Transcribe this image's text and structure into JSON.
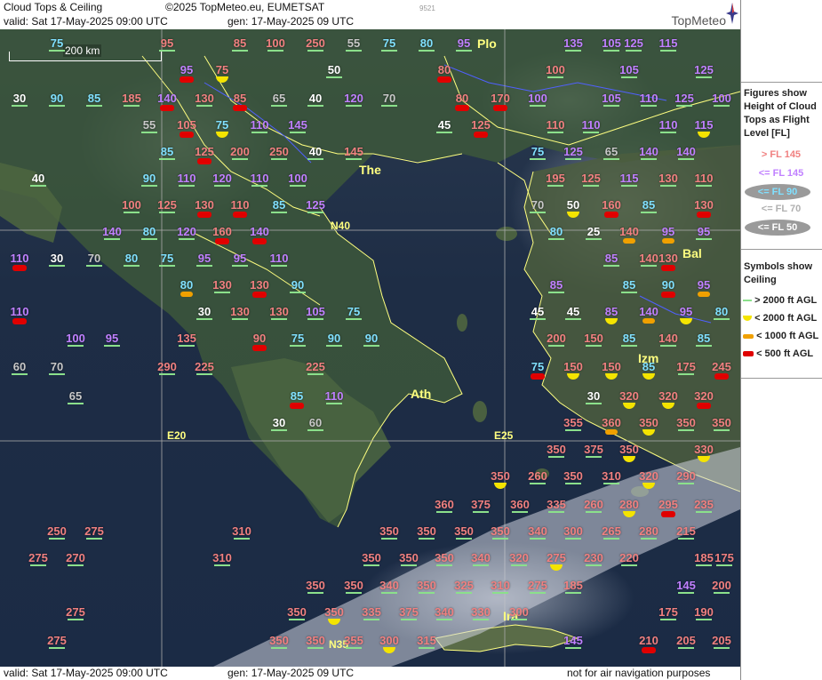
{
  "header": {
    "title": "Cloud Tops & Ceiling",
    "copyright": "©2025 TopMeteo.eu, EUMETSAT",
    "valid": "valid:  Sat  17-May-2025  09:00 UTC",
    "gen": "gen: 17-May-2025 09 UTC",
    "code": "9521",
    "logo": "TopMeteo"
  },
  "footer": {
    "valid": "valid:  Sat  17-May-2025  09:00 UTC",
    "gen": "gen: 17-May-2025 09 UTC",
    "disclaimer": "not for air navigation purposes"
  },
  "scale": "200 km",
  "legend": {
    "figures_title": "Figures show Height of Cloud Tops as Flight Level  [FL]",
    "levels": [
      {
        "label": "> FL 145",
        "color": "#f08080"
      },
      {
        "label": "<= FL 145",
        "color": "#c080ff"
      },
      {
        "label": "<= FL 90",
        "color": "#80e0ff"
      },
      {
        "label": "<= FL 70",
        "color": "#c8c8c8"
      },
      {
        "label": "<= FL 50",
        "color": "#ffffff"
      }
    ],
    "symbols_title": "Symbols show Ceiling",
    "symbols": [
      {
        "label": "> 2000 ft AGL",
        "icon": "green-line-icon"
      },
      {
        "label": "< 2000 ft AGL",
        "icon": "yellow-half-disc-icon"
      },
      {
        "label": "< 1000 ft AGL",
        "icon": "orange-bar-icon"
      },
      {
        "label": "< 500 ft AGL",
        "icon": "red-bar-icon"
      }
    ]
  },
  "cities": [
    "The",
    "Ath",
    "Izm",
    "Bal",
    "Plo",
    "Ira"
  ],
  "gridlabels": [
    "N40",
    "N35",
    "E20",
    "E25"
  ],
  "observations": [
    {
      "v": "75",
      "c": "f",
      "s": "ln"
    },
    {
      "v": "95",
      "c": "h",
      "s": "ln"
    },
    {
      "v": "85",
      "c": "h",
      "s": "ln"
    },
    {
      "v": "250",
      "c": "h",
      "s": "ln"
    },
    {
      "v": "100",
      "c": "h",
      "s": "ln"
    },
    {
      "v": "55",
      "c": "g",
      "s": "ln"
    },
    {
      "v": "75",
      "c": "f",
      "s": "ln"
    },
    {
      "v": "80",
      "c": "f",
      "s": "ln"
    },
    {
      "v": "95",
      "c": "m",
      "s": "ln"
    },
    {
      "v": "Plo",
      "c": "c",
      "s": ""
    },
    {
      "v": "125",
      "c": "m",
      "s": "ln"
    },
    {
      "v": "135",
      "c": "m",
      "s": "ln"
    },
    {
      "v": "105",
      "c": "m",
      "s": "ln"
    },
    {
      "v": "115",
      "c": "m",
      "s": "ln"
    },
    {
      "v": "95",
      "c": "m",
      "s": "re"
    },
    {
      "v": "75",
      "c": "h",
      "s": "ye"
    },
    {
      "v": "50",
      "c": "w",
      "s": "ln"
    },
    {
      "v": "80",
      "c": "h",
      "s": "re"
    },
    {
      "v": "100",
      "c": "h",
      "s": "ln"
    },
    {
      "v": "105",
      "c": "m",
      "s": "ln"
    },
    {
      "v": "125",
      "c": "m",
      "s": "ln"
    },
    {
      "v": "30",
      "c": "w",
      "s": "ln"
    },
    {
      "v": "90",
      "c": "f",
      "s": "ln"
    },
    {
      "v": "85",
      "c": "f",
      "s": "ln"
    },
    {
      "v": "185",
      "c": "h",
      "s": "ln"
    },
    {
      "v": "140",
      "c": "m",
      "s": "re"
    },
    {
      "v": "130",
      "c": "h",
      "s": "ln"
    },
    {
      "v": "85",
      "c": "h",
      "s": "re"
    },
    {
      "v": "65",
      "c": "g",
      "s": "ln"
    },
    {
      "v": "40",
      "c": "w",
      "s": "ln"
    },
    {
      "v": "120",
      "c": "m",
      "s": "ln"
    },
    {
      "v": "70",
      "c": "g",
      "s": "ln"
    },
    {
      "v": "80",
      "c": "h",
      "s": "re"
    },
    {
      "v": "170",
      "c": "h",
      "s": "re"
    },
    {
      "v": "100",
      "c": "m",
      "s": "ln"
    },
    {
      "v": "105",
      "c": "m",
      "s": "ln"
    },
    {
      "v": "110",
      "c": "m",
      "s": "ln"
    },
    {
      "v": "125",
      "c": "m",
      "s": "ln"
    },
    {
      "v": "100",
      "c": "m",
      "s": "ln"
    },
    {
      "v": "55",
      "c": "g",
      "s": "ln"
    },
    {
      "v": "105",
      "c": "h",
      "s": "re"
    },
    {
      "v": "75",
      "c": "f",
      "s": "ye"
    },
    {
      "v": "110",
      "c": "m",
      "s": "ln"
    },
    {
      "v": "145",
      "c": "m",
      "s": "ln"
    },
    {
      "v": "45",
      "c": "w",
      "s": "ln"
    },
    {
      "v": "125",
      "c": "h",
      "s": "re"
    },
    {
      "v": "110",
      "c": "h",
      "s": "ln"
    },
    {
      "v": "110",
      "c": "m",
      "s": "ln"
    },
    {
      "v": "110",
      "c": "m",
      "s": "ln"
    },
    {
      "v": "115",
      "c": "m",
      "s": "ye"
    },
    {
      "v": "85",
      "c": "f",
      "s": "ln"
    },
    {
      "v": "125",
      "c": "h",
      "s": "re"
    },
    {
      "v": "200",
      "c": "h",
      "s": "ln"
    },
    {
      "v": "250",
      "c": "h",
      "s": "ln"
    },
    {
      "v": "40",
      "c": "w",
      "s": "ln"
    },
    {
      "v": "145",
      "c": "h",
      "s": "ln"
    },
    {
      "v": "75",
      "c": "f",
      "s": "ln"
    },
    {
      "v": "125",
      "c": "m",
      "s": "ln"
    },
    {
      "v": "65",
      "c": "g",
      "s": "ln"
    },
    {
      "v": "140",
      "c": "m",
      "s": "ln"
    },
    {
      "v": "140",
      "c": "m",
      "s": "ln"
    },
    {
      "v": "40",
      "c": "w",
      "s": "ln"
    },
    {
      "v": "90",
      "c": "f",
      "s": "ln"
    },
    {
      "v": "110",
      "c": "m",
      "s": "ln"
    },
    {
      "v": "120",
      "c": "m",
      "s": "ln"
    },
    {
      "v": "110",
      "c": "m",
      "s": "ln"
    },
    {
      "v": "100",
      "c": "m",
      "s": "ln"
    },
    {
      "v": "195",
      "c": "h",
      "s": "ln"
    },
    {
      "v": "125",
      "c": "h",
      "s": "ln"
    },
    {
      "v": "115",
      "c": "m",
      "s": "ln"
    },
    {
      "v": "130",
      "c": "h",
      "s": "ln"
    },
    {
      "v": "110",
      "c": "h",
      "s": "ln"
    },
    {
      "v": "100",
      "c": "h",
      "s": "ln"
    },
    {
      "v": "125",
      "c": "h",
      "s": "ln"
    },
    {
      "v": "130",
      "c": "h",
      "s": "re"
    },
    {
      "v": "110",
      "c": "h",
      "s": "re"
    },
    {
      "v": "85",
      "c": "f",
      "s": "ln"
    },
    {
      "v": "125",
      "c": "m",
      "s": "ln"
    },
    {
      "v": "70",
      "c": "g",
      "s": "ln"
    },
    {
      "v": "50",
      "c": "w",
      "s": "ye"
    },
    {
      "v": "160",
      "c": "h",
      "s": "re"
    },
    {
      "v": "85",
      "c": "f",
      "s": "ln"
    },
    {
      "v": "130",
      "c": "h",
      "s": "re"
    },
    {
      "v": "140",
      "c": "m",
      "s": "ln"
    },
    {
      "v": "80",
      "c": "f",
      "s": "ln"
    },
    {
      "v": "120",
      "c": "m",
      "s": "ln"
    },
    {
      "v": "160",
      "c": "h",
      "s": "re"
    },
    {
      "v": "140",
      "c": "m",
      "s": "re"
    },
    {
      "v": "80",
      "c": "f",
      "s": "ln"
    },
    {
      "v": "25",
      "c": "w",
      "s": "ln"
    },
    {
      "v": "140",
      "c": "h",
      "s": "or"
    },
    {
      "v": "95",
      "c": "m",
      "s": "or"
    },
    {
      "v": "95",
      "c": "m",
      "s": "ln"
    },
    {
      "v": "110",
      "c": "m",
      "s": "re"
    },
    {
      "v": "30",
      "c": "w",
      "s": "ln"
    },
    {
      "v": "70",
      "c": "g",
      "s": "ln"
    },
    {
      "v": "80",
      "c": "f",
      "s": "ln"
    },
    {
      "v": "75",
      "c": "f",
      "s": "ln"
    },
    {
      "v": "95",
      "c": "m",
      "s": "ln"
    },
    {
      "v": "95",
      "c": "m",
      "s": "ln"
    },
    {
      "v": "110",
      "c": "m",
      "s": "ln"
    },
    {
      "v": "85",
      "c": "m",
      "s": "ln"
    },
    {
      "v": "140",
      "c": "h",
      "s": "ln"
    },
    {
      "v": "130",
      "c": "h",
      "s": "re"
    },
    {
      "v": "80",
      "c": "f",
      "s": "or"
    },
    {
      "v": "130",
      "c": "h",
      "s": "ln"
    },
    {
      "v": "130",
      "c": "h",
      "s": "re"
    },
    {
      "v": "90",
      "c": "f",
      "s": "ln"
    },
    {
      "v": "85",
      "c": "m",
      "s": "ln"
    },
    {
      "v": "85",
      "c": "f",
      "s": "ln"
    },
    {
      "v": "90",
      "c": "f",
      "s": "re"
    },
    {
      "v": "95",
      "c": "m",
      "s": "or"
    },
    {
      "v": "110",
      "c": "m",
      "s": "re"
    },
    {
      "v": "30",
      "c": "w",
      "s": "ln"
    },
    {
      "v": "130",
      "c": "h",
      "s": "ln"
    },
    {
      "v": "130",
      "c": "h",
      "s": "ln"
    },
    {
      "v": "105",
      "c": "m",
      "s": "ln"
    },
    {
      "v": "75",
      "c": "f",
      "s": "ln"
    },
    {
      "v": "45",
      "c": "w",
      "s": "ln"
    },
    {
      "v": "45",
      "c": "w",
      "s": "ln"
    },
    {
      "v": "85",
      "c": "m",
      "s": "ye"
    },
    {
      "v": "140",
      "c": "m",
      "s": "or"
    },
    {
      "v": "95",
      "c": "m",
      "s": "ye"
    },
    {
      "v": "80",
      "c": "f",
      "s": "ln"
    },
    {
      "v": "100",
      "c": "m",
      "s": "ln"
    },
    {
      "v": "95",
      "c": "m",
      "s": "ln"
    },
    {
      "v": "135",
      "c": "h",
      "s": "ln"
    },
    {
      "v": "90",
      "c": "h",
      "s": "re"
    },
    {
      "v": "75",
      "c": "f",
      "s": "ln"
    },
    {
      "v": "90",
      "c": "f",
      "s": "ln"
    },
    {
      "v": "90",
      "c": "f",
      "s": "ln"
    },
    {
      "v": "200",
      "c": "h",
      "s": "ln"
    },
    {
      "v": "150",
      "c": "h",
      "s": "ln"
    },
    {
      "v": "85",
      "c": "f",
      "s": "ln"
    },
    {
      "v": "140",
      "c": "h",
      "s": "ln"
    },
    {
      "v": "85",
      "c": "f",
      "s": "ln"
    },
    {
      "v": "60",
      "c": "g",
      "s": "ln"
    },
    {
      "v": "70",
      "c": "g",
      "s": "ln"
    },
    {
      "v": "290",
      "c": "h",
      "s": "ln"
    },
    {
      "v": "225",
      "c": "h",
      "s": "ln"
    },
    {
      "v": "225",
      "c": "h",
      "s": "ln"
    },
    {
      "v": "75",
      "c": "f",
      "s": "re"
    },
    {
      "v": "150",
      "c": "h",
      "s": "ye"
    },
    {
      "v": "150",
      "c": "h",
      "s": "ye"
    },
    {
      "v": "85",
      "c": "f",
      "s": "ye"
    },
    {
      "v": "175",
      "c": "h",
      "s": "ln"
    },
    {
      "v": "245",
      "c": "h",
      "s": "re"
    },
    {
      "v": "65",
      "c": "g",
      "s": "ln"
    },
    {
      "v": "85",
      "c": "f",
      "s": "re"
    },
    {
      "v": "110",
      "c": "m",
      "s": "ln"
    },
    {
      "v": "30",
      "c": "w",
      "s": "ln"
    },
    {
      "v": "320",
      "c": "h",
      "s": "ye"
    },
    {
      "v": "320",
      "c": "h",
      "s": "ye"
    },
    {
      "v": "320",
      "c": "h",
      "s": "re"
    },
    {
      "v": "30",
      "c": "w",
      "s": "ln"
    },
    {
      "v": "60",
      "c": "g",
      "s": "ln"
    },
    {
      "v": "355",
      "c": "h",
      "s": "ln"
    },
    {
      "v": "360",
      "c": "h",
      "s": "or"
    },
    {
      "v": "350",
      "c": "h",
      "s": "ye"
    },
    {
      "v": "350",
      "c": "h",
      "s": "ln"
    },
    {
      "v": "350",
      "c": "h",
      "s": "ln"
    },
    {
      "v": "350",
      "c": "h",
      "s": "ln"
    },
    {
      "v": "375",
      "c": "h",
      "s": "ln"
    },
    {
      "v": "350",
      "c": "h",
      "s": "ye"
    },
    {
      "v": "330",
      "c": "h",
      "s": "ye"
    },
    {
      "v": "350",
      "c": "h",
      "s": "ye"
    },
    {
      "v": "260",
      "c": "h",
      "s": "ln"
    },
    {
      "v": "350",
      "c": "h",
      "s": "ln"
    },
    {
      "v": "310",
      "c": "h",
      "s": "ln"
    },
    {
      "v": "320",
      "c": "h",
      "s": "ye"
    },
    {
      "v": "290",
      "c": "h",
      "s": "ln"
    },
    {
      "v": "360",
      "c": "h",
      "s": "ln"
    },
    {
      "v": "375",
      "c": "h",
      "s": "ln"
    },
    {
      "v": "360",
      "c": "h",
      "s": "ln"
    },
    {
      "v": "335",
      "c": "h",
      "s": "ln"
    },
    {
      "v": "260",
      "c": "h",
      "s": "ln"
    },
    {
      "v": "280",
      "c": "h",
      "s": "ye"
    },
    {
      "v": "295",
      "c": "h",
      "s": "re"
    },
    {
      "v": "235",
      "c": "h",
      "s": "ln"
    },
    {
      "v": "250",
      "c": "h",
      "s": "ln"
    },
    {
      "v": "275",
      "c": "h",
      "s": "ln"
    },
    {
      "v": "310",
      "c": "h",
      "s": "ln"
    },
    {
      "v": "350",
      "c": "h",
      "s": "ln"
    },
    {
      "v": "350",
      "c": "h",
      "s": "ln"
    },
    {
      "v": "350",
      "c": "h",
      "s": "ln"
    },
    {
      "v": "350",
      "c": "h",
      "s": "ln"
    },
    {
      "v": "340",
      "c": "h",
      "s": "ln"
    },
    {
      "v": "300",
      "c": "h",
      "s": "ln"
    },
    {
      "v": "265",
      "c": "h",
      "s": "ln"
    },
    {
      "v": "280",
      "c": "h",
      "s": "ln"
    },
    {
      "v": "215",
      "c": "h",
      "s": "ln"
    },
    {
      "v": "275",
      "c": "h",
      "s": "ln"
    },
    {
      "v": "270",
      "c": "h",
      "s": "ln"
    },
    {
      "v": "310",
      "c": "h",
      "s": "ln"
    },
    {
      "v": "350",
      "c": "h",
      "s": "ln"
    },
    {
      "v": "350",
      "c": "h",
      "s": "ln"
    },
    {
      "v": "350",
      "c": "h",
      "s": "ln"
    },
    {
      "v": "340",
      "c": "h",
      "s": "ln"
    },
    {
      "v": "320",
      "c": "h",
      "s": "ln"
    },
    {
      "v": "275",
      "c": "h",
      "s": "ye"
    },
    {
      "v": "230",
      "c": "h",
      "s": "ln"
    },
    {
      "v": "220",
      "c": "h",
      "s": "ln"
    },
    {
      "v": "185",
      "c": "h",
      "s": "ln"
    },
    {
      "v": "175",
      "c": "h",
      "s": "ln"
    },
    {
      "v": "350",
      "c": "h",
      "s": "ln"
    },
    {
      "v": "350",
      "c": "h",
      "s": "ln"
    },
    {
      "v": "340",
      "c": "h",
      "s": "ln"
    },
    {
      "v": "350",
      "c": "h",
      "s": "ln"
    },
    {
      "v": "325",
      "c": "h",
      "s": "ln"
    },
    {
      "v": "310",
      "c": "h",
      "s": "ln"
    },
    {
      "v": "275",
      "c": "h",
      "s": "ln"
    },
    {
      "v": "185",
      "c": "h",
      "s": "ln"
    },
    {
      "v": "145",
      "c": "m",
      "s": "ln"
    },
    {
      "v": "200",
      "c": "h",
      "s": "ln"
    },
    {
      "v": "275",
      "c": "h",
      "s": "ln"
    },
    {
      "v": "350",
      "c": "h",
      "s": "ln"
    },
    {
      "v": "350",
      "c": "h",
      "s": "ye"
    },
    {
      "v": "335",
      "c": "h",
      "s": "ln"
    },
    {
      "v": "375",
      "c": "h",
      "s": "ln"
    },
    {
      "v": "340",
      "c": "h",
      "s": "ln"
    },
    {
      "v": "330",
      "c": "h",
      "s": "ln"
    },
    {
      "v": "300",
      "c": "h",
      "s": "ln"
    },
    {
      "v": "175",
      "c": "h",
      "s": "ln"
    },
    {
      "v": "190",
      "c": "h",
      "s": "ln"
    },
    {
      "v": "275",
      "c": "h",
      "s": "ln"
    },
    {
      "v": "350",
      "c": "h",
      "s": "ln"
    },
    {
      "v": "350",
      "c": "h",
      "s": "ln"
    },
    {
      "v": "355",
      "c": "h",
      "s": "ln"
    },
    {
      "v": "300",
      "c": "h",
      "s": "ye"
    },
    {
      "v": "315",
      "c": "h",
      "s": "ln"
    },
    {
      "v": "145",
      "c": "m",
      "s": "ln"
    },
    {
      "v": "210",
      "c": "h",
      "s": "re"
    },
    {
      "v": "205",
      "c": "h",
      "s": "ln"
    },
    {
      "v": "205",
      "c": "h",
      "s": "ln"
    }
  ]
}
